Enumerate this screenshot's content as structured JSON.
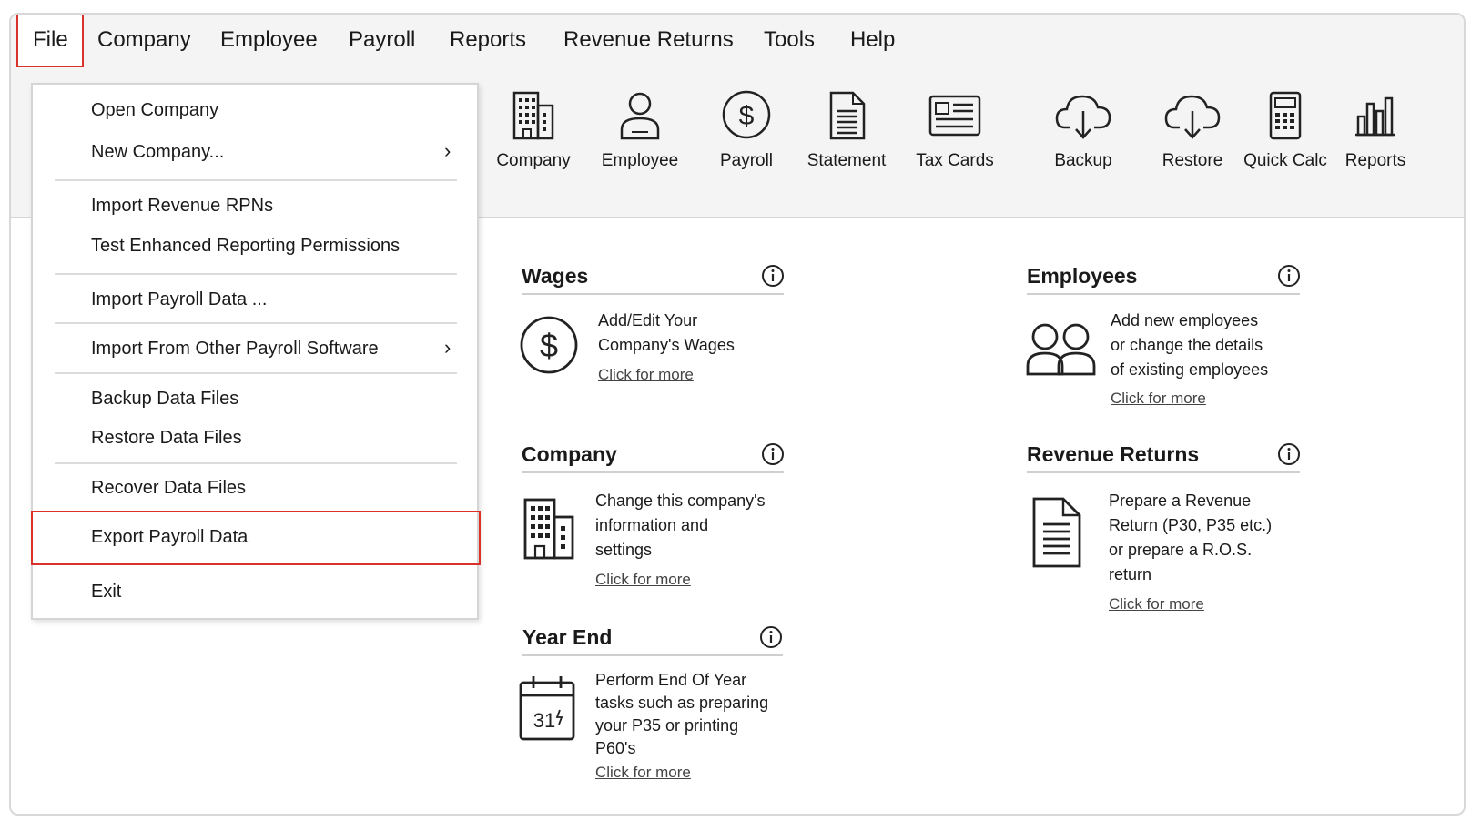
{
  "menu": {
    "file": "File",
    "company": "Company",
    "employee": "Employee",
    "payroll": "Payroll",
    "reports": "Reports",
    "revenue_returns": "Revenue Returns",
    "tools": "Tools",
    "help": "Help"
  },
  "toolbar": {
    "company": "Company",
    "employee": "Employee",
    "payroll": "Payroll",
    "statement": "Statement",
    "tax_cards": "Tax Cards",
    "backup": "Backup",
    "restore": "Restore",
    "quick_calc": "Quick Calc",
    "reports": "Reports"
  },
  "file_menu": {
    "open_company": "Open Company",
    "new_company": "New Company...",
    "import_rpns": "Import Revenue RPNs",
    "test_permissions": "Test Enhanced Reporting Permissions",
    "import_payroll": "Import Payroll Data ...",
    "import_other": "Import From Other Payroll Software",
    "backup_files": "Backup Data Files",
    "restore_files": "Restore Data Files",
    "recover_files": "Recover Data Files",
    "export_payroll": "Export Payroll Data",
    "exit": "Exit",
    "submenu_arrow": "›"
  },
  "cards": {
    "wages": {
      "title": "Wages",
      "line1": "Add/Edit Your",
      "line2": "Company's Wages",
      "link": "Click for more"
    },
    "employees": {
      "title": "Employees",
      "line1": "Add new employees",
      "line2": "or change the details",
      "line3": "of existing employees",
      "link": "Click for more"
    },
    "company": {
      "title": "Company",
      "line1": "Change this company's",
      "line2": "information and",
      "line3": "settings",
      "link": "Click for more"
    },
    "revenue_returns": {
      "title": "Revenue Returns",
      "line1": "Prepare a Revenue",
      "line2": "Return (P30, P35 etc.)",
      "line3": "or prepare a R.O.S.",
      "line4": "return",
      "link": "Click for more"
    },
    "year_end": {
      "title": "Year End",
      "line1": "Perform End Of Year",
      "line2": "tasks such as preparing",
      "line3": "your P35 or printing",
      "line4": "P60's",
      "link": "Click for more",
      "calendar_day": "31"
    }
  },
  "colors": {
    "highlight": "#d9322b",
    "bar_bg": "#f4f4f4"
  }
}
